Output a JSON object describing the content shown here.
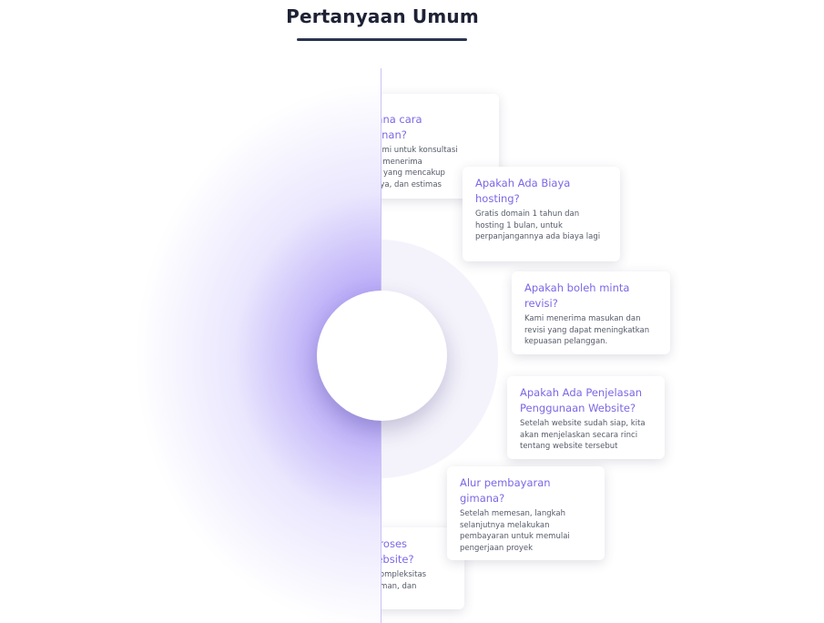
{
  "section": {
    "title": "Pertanyaan Umum"
  },
  "faq": {
    "items": [
      {
        "question": "Bagaimana cara memesan?",
        "question_visible": "imana cara\nesanan?",
        "answer_visible": "gi kami untuk konsultasi\n dan menerima\naran yang mencakup\n, biaya, dan estimas"
      },
      {
        "question": "Apakah Ada Biaya hosting?",
        "answer": "Gratis domain 1 tahun dan hosting 1 bulan, untuk perpanjangannya ada biaya lagi"
      },
      {
        "question": "Apakah boleh minta revisi?",
        "answer": "Kami menerima masukan dan revisi yang dapat meningkatkan kepuasan pelanggan."
      },
      {
        "question": "Apakah Ada Penjelasan Penggunaan Website?",
        "answer": "Setelah website sudah siap, kita akan menjelaskan secara rinci tentang website tersebut"
      },
      {
        "question": "Alur pembayaran gimana?",
        "answer": "Setelah memesan, langkah selanjutnya melakukan pembayaran untuk memulai pengerjaan proyek"
      },
      {
        "question_visible": "a Proses\n Website?",
        "answer_visible": "da kompleksitas\nhalaman, dan\nusus"
      }
    ]
  },
  "colors": {
    "accent": "#7c67e6",
    "title": "#1e2235",
    "glow": "#8e7af0"
  }
}
